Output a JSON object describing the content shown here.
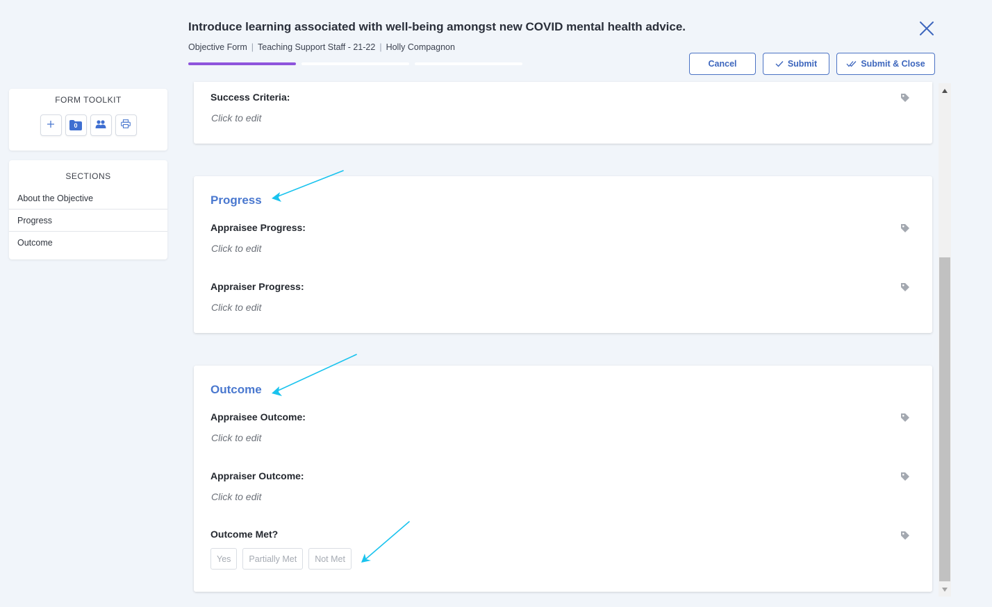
{
  "header": {
    "title": "Introduce learning associated with well-being amongst new COVID mental health advice.",
    "breadcrumb": [
      "Objective Form",
      "Teaching Support Staff - 21-22",
      "Holly Compagnon"
    ],
    "buttons": {
      "cancel": "Cancel",
      "submit": "Submit",
      "submit_close": "Submit & Close"
    },
    "steps": [
      {
        "active": true
      },
      {
        "active": false
      },
      {
        "active": false
      }
    ]
  },
  "toolkit": {
    "title": "FORM TOOLKIT",
    "tools": [
      {
        "icon": "plus-icon"
      },
      {
        "icon": "folder-icon",
        "badge": "0"
      },
      {
        "icon": "users-icon"
      },
      {
        "icon": "print-icon"
      }
    ]
  },
  "sections": {
    "title": "SECTIONS",
    "items": [
      "About the Objective",
      "Progress",
      "Outcome"
    ]
  },
  "cards": {
    "success_criteria": {
      "label": "Success Criteria:",
      "value": "Click to edit"
    },
    "progress": {
      "heading": "Progress",
      "fields": [
        {
          "label": "Appraisee Progress:",
          "value": "Click to edit"
        },
        {
          "label": "Appraiser Progress:",
          "value": "Click to edit"
        }
      ]
    },
    "outcome": {
      "heading": "Outcome",
      "fields": [
        {
          "label": "Appraisee Outcome:",
          "value": "Click to edit"
        },
        {
          "label": "Appraiser Outcome:",
          "value": "Click to edit"
        }
      ],
      "met": {
        "label": "Outcome Met?",
        "options": [
          "Yes",
          "Partially Met",
          "Not Met"
        ]
      }
    }
  },
  "colors": {
    "accent": "#4a78cf",
    "progress_active": "#8e54dc",
    "annotation_arrow": "#19c3ee"
  }
}
